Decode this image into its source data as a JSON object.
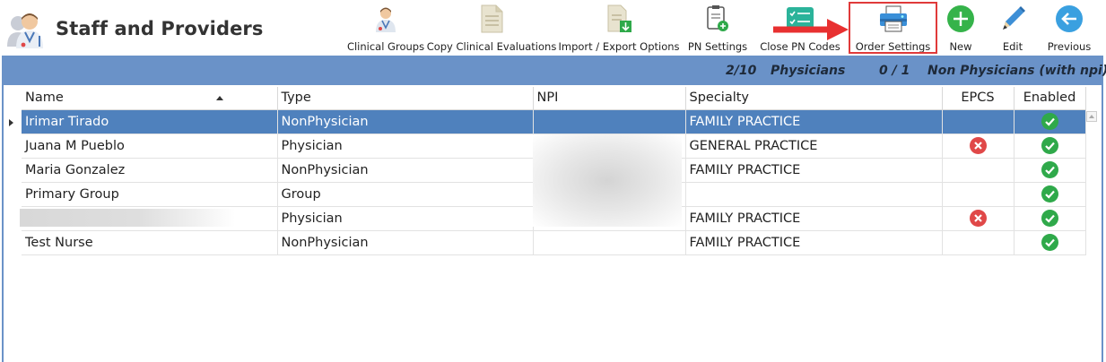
{
  "header": {
    "title": "Staff and Providers"
  },
  "toolbar": {
    "clinical_groups": "Clinical Groups",
    "copy_clinical_evaluations": "Copy Clinical Evaluations",
    "import_export_options": "Import / Export Options",
    "pn_settings": "PN Settings",
    "close_pn_codes": "Close PN Codes",
    "order_settings": "Order Settings",
    "new": "New",
    "edit": "Edit",
    "previous": "Previous"
  },
  "summary": {
    "physicians_count": "2/10",
    "physicians_label": "Physicians",
    "non_physicians_count": "0 / 1",
    "non_physicians_label": "Non Physicians (with npi)"
  },
  "grid": {
    "columns": {
      "name": "Name",
      "type": "Type",
      "npi": "NPI",
      "specialty": "Specialty",
      "epcs": "EPCS",
      "enabled": "Enabled"
    },
    "rows": [
      {
        "name": "Irimar Tirado",
        "type": "NonPhysician",
        "specialty": "FAMILY PRACTICE",
        "epcs": "",
        "enabled": "yes"
      },
      {
        "name": "Juana M Pueblo",
        "type": "Physician",
        "specialty": "GENERAL PRACTICE",
        "epcs": "no",
        "enabled": "yes"
      },
      {
        "name": "Maria Gonzalez",
        "type": "NonPhysician",
        "specialty": "FAMILY PRACTICE",
        "epcs": "",
        "enabled": "yes"
      },
      {
        "name": "Primary Group",
        "type": "Group",
        "specialty": "",
        "epcs": "",
        "enabled": "yes"
      },
      {
        "name": "",
        "type": "Physician",
        "specialty": "FAMILY PRACTICE",
        "epcs": "no",
        "enabled": "yes"
      },
      {
        "name": "Test Nurse",
        "type": "NonPhysician",
        "specialty": "FAMILY PRACTICE",
        "epcs": "",
        "enabled": "yes"
      }
    ]
  },
  "colors": {
    "accent_bar": "#6a92c8",
    "selected_row": "#4f81bd",
    "enabled_green": "#2fa94a",
    "epcs_red": "#e04848",
    "highlight": "#e03a3a"
  },
  "icons": {
    "logo": "staff-logo-icon",
    "clinical_groups": "doctor-icon",
    "copy_clinical_evaluations": "document-icon",
    "import_export_options": "document-download-icon",
    "pn_settings": "clipboard-add-icon",
    "close_pn_codes": "checklist-icon",
    "order_settings": "printer-icon",
    "new": "plus-circle-icon",
    "edit": "pencil-icon",
    "previous": "arrow-left-circle-icon"
  }
}
